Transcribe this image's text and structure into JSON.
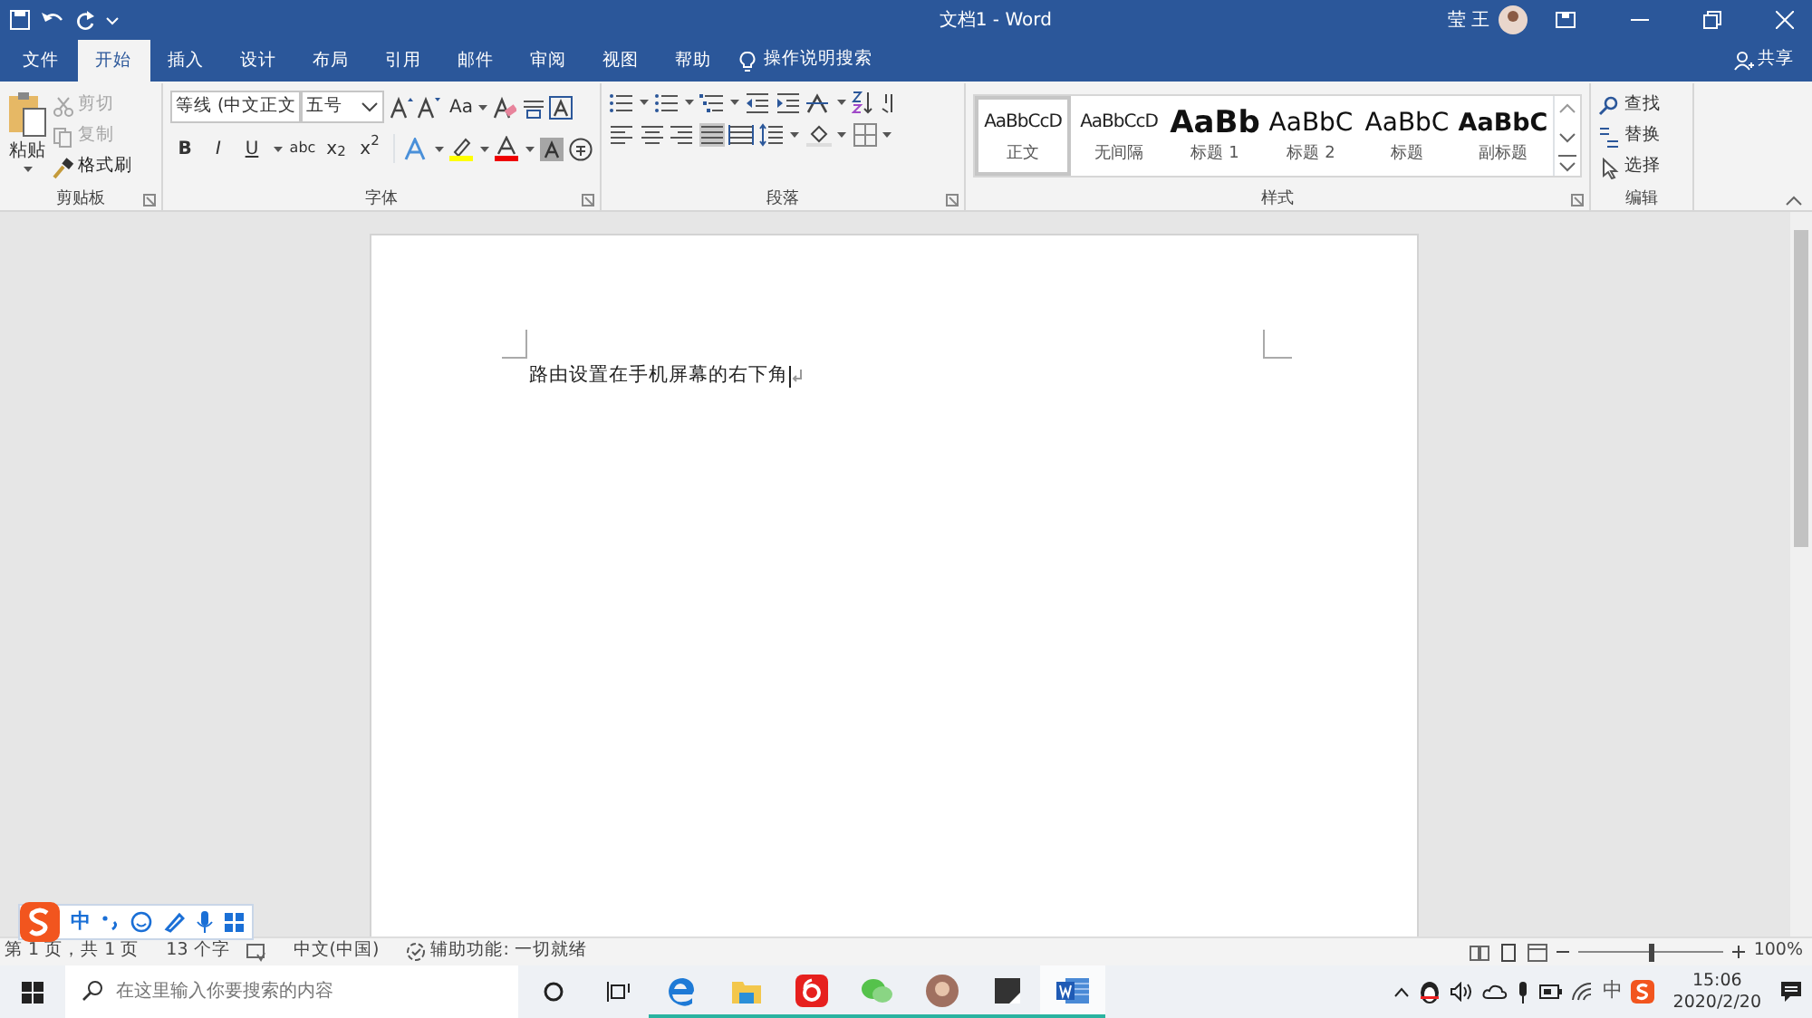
{
  "title_bar": {
    "title": "文档1  -  Word",
    "user": "莹 王"
  },
  "tabs": [
    {
      "label": "文件",
      "selected": false
    },
    {
      "label": "开始",
      "selected": true
    },
    {
      "label": "插入",
      "selected": false
    },
    {
      "label": "设计",
      "selected": false
    },
    {
      "label": "布局",
      "selected": false
    },
    {
      "label": "引用",
      "selected": false
    },
    {
      "label": "邮件",
      "selected": false
    },
    {
      "label": "审阅",
      "selected": false
    },
    {
      "label": "视图",
      "selected": false
    },
    {
      "label": "帮助",
      "selected": false
    }
  ],
  "tell_me": "操作说明搜索",
  "share": "共享",
  "clipboard": {
    "label": "剪贴板",
    "paste": "粘贴",
    "items": [
      {
        "label": "剪切",
        "disabled": true
      },
      {
        "label": "复制",
        "disabled": true
      },
      {
        "label": "格式刷",
        "disabled": false
      }
    ]
  },
  "font": {
    "label": "字体",
    "font_name": "等线 (中文正文",
    "font_size": "五号",
    "case_button": "Aa",
    "format_buttons": [
      "B",
      "I",
      "U",
      "abc",
      "x$_{2}$",
      "x$^{2}$"
    ]
  },
  "paragraph": {
    "label": "段落",
    "alignments": [
      {
        "selected": false
      },
      {
        "selected": false
      },
      {
        "selected": false
      },
      {
        "selected": true
      },
      {
        "selected": false
      }
    ]
  },
  "styles": {
    "label": "样式",
    "items": [
      {
        "preview": "AaBbCcD",
        "name": "正文",
        "kind": "body",
        "selected": true
      },
      {
        "preview": "AaBbCcD",
        "name": "无间隔",
        "kind": "body",
        "selected": false
      },
      {
        "preview": "AaBb",
        "name": "标题 1",
        "kind": "heading1",
        "selected": false
      },
      {
        "preview": "AaBbC",
        "name": "标题 2",
        "kind": "heading2",
        "selected": false
      },
      {
        "preview": "AaBbC",
        "name": "标题",
        "kind": "title",
        "selected": false
      },
      {
        "preview": "AaBbC",
        "name": "副标题",
        "kind": "subtitle",
        "selected": false
      }
    ]
  },
  "editing": {
    "label": "编辑",
    "items": [
      "查找",
      "替换",
      "选择"
    ]
  },
  "document": {
    "text": "路由设置在手机屏幕的右下角"
  },
  "status_bar": {
    "page": "第 1 页，共 1 页",
    "words": "13 个字",
    "language": "中文(中国)",
    "accessibility": "辅助功能: 一切就绪",
    "zoom": "100%",
    "zoom_slider": {
      "level": 0.5
    }
  },
  "ime_toolbar": {
    "mode": "中"
  },
  "taskbar": {
    "search_placeholder": "在这里输入你要搜索的内容",
    "apps": [
      {
        "running": true,
        "active": false
      },
      {
        "running": true,
        "active": false
      },
      {
        "running": true,
        "active": false
      },
      {
        "running": true,
        "active": false
      },
      {
        "running": true,
        "active": false
      },
      {
        "running": true,
        "active": false
      },
      {
        "running": true,
        "active": true
      }
    ],
    "input_mode": "中",
    "time": "15:06",
    "date": "2020/2/20"
  }
}
